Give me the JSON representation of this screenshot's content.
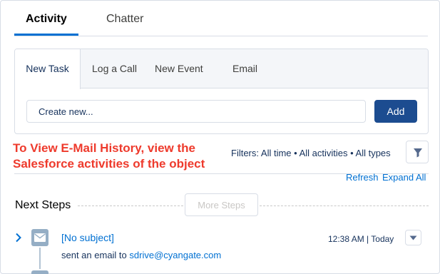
{
  "top_tabs": [
    {
      "label": "Activity",
      "active": true
    },
    {
      "label": "Chatter",
      "active": false
    }
  ],
  "composer": {
    "tabs": [
      {
        "label": "New Task",
        "active": true
      },
      {
        "label": "Log a Call"
      },
      {
        "label": "New Event"
      },
      {
        "label": "Email"
      }
    ],
    "input_placeholder": "Create new...",
    "add_label": "Add"
  },
  "annotation": {
    "line1": "To View E-Mail History, view the",
    "line2": "Salesforce activities of the object",
    "color": "#ee3a2c"
  },
  "filters": {
    "text": "Filters: All time • All activities • All types",
    "icon": "filter-icon"
  },
  "links": {
    "refresh": "Refresh",
    "expand_all": "Expand All"
  },
  "next_steps": {
    "title": "Next Steps",
    "more_label": "More Steps"
  },
  "timeline": {
    "items": [
      {
        "icon": "email-icon",
        "subject": "[No subject]",
        "time": "12:38 AM | Today",
        "description_prefix": "sent an email to",
        "recipient": "sdrive@cyangate.com"
      }
    ]
  },
  "colors": {
    "brand": "#1c4c90",
    "link": "#0070d2",
    "text": "#16325c"
  }
}
